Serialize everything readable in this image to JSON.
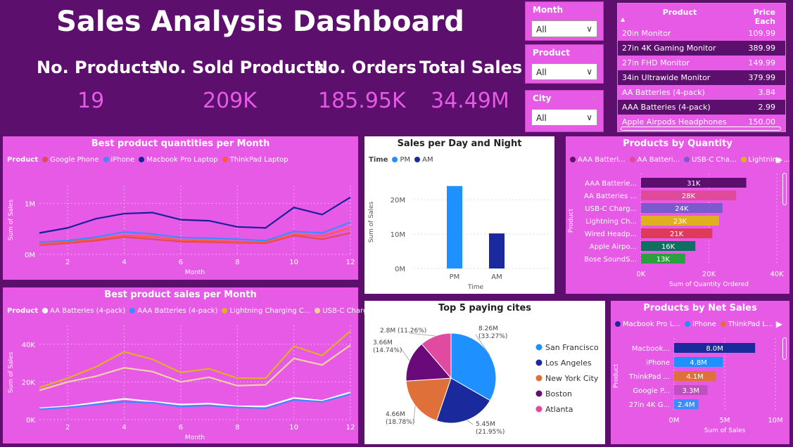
{
  "title": "Sales Analysis Dashboard",
  "kpis": [
    {
      "label": "No. Products",
      "value": "19"
    },
    {
      "label": "No. Sold Products",
      "value": "209K"
    },
    {
      "label": "No. Orders",
      "value": "185.95K"
    },
    {
      "label": "Total Sales",
      "value": "34.49M"
    }
  ],
  "slicers": [
    {
      "label": "Month",
      "value": "All"
    },
    {
      "label": "Product",
      "value": "All"
    },
    {
      "label": "City",
      "value": "All"
    }
  ],
  "price_table": {
    "headers": [
      "Product",
      "Price Each"
    ],
    "rows": [
      [
        "20in Monitor",
        "109.99"
      ],
      [
        "27in 4K Gaming Monitor",
        "389.99"
      ],
      [
        "27in FHD Monitor",
        "149.99"
      ],
      [
        "34in Ultrawide Monitor",
        "379.99"
      ],
      [
        "AA Batteries (4-pack)",
        "3.84"
      ],
      [
        "AAA Batteries (4-pack)",
        "2.99"
      ],
      [
        "Apple Airpods Headphones",
        "150.00"
      ]
    ]
  },
  "colors": {
    "bg": "#5d0f6e",
    "panel": "#e65ae6",
    "google_phone": "#e04a5a",
    "iphone": "#3a8cff",
    "macbook": "#1a1f9c",
    "thinkpad": "#ff5a3a",
    "aa": "#ffffff",
    "aaa": "#3a8cff",
    "lightning": "#e0b020",
    "usbc": "#f0d4a0"
  },
  "chart_data": [
    {
      "type": "line",
      "title": "Best product quantities per Month",
      "legend_title": "Product",
      "xlabel": "Month",
      "ylabel": "Sum of Sales",
      "x": [
        1,
        2,
        3,
        4,
        5,
        6,
        7,
        8,
        9,
        10,
        11,
        12
      ],
      "xticks": [
        "2",
        "4",
        "6",
        "8",
        "10",
        "12"
      ],
      "yticks": [
        "0M",
        "1M"
      ],
      "ylim": [
        0,
        1350000
      ],
      "series": [
        {
          "name": "Google Phone",
          "color": "#e04a5a",
          "values": [
            180000,
            220000,
            270000,
            340000,
            300000,
            250000,
            240000,
            230000,
            220000,
            370000,
            300000,
            420000
          ]
        },
        {
          "name": "iPhone",
          "color": "#3a8cff",
          "values": [
            240000,
            270000,
            340000,
            440000,
            400000,
            330000,
            320000,
            300000,
            270000,
            450000,
            420000,
            630000
          ]
        },
        {
          "name": "Macbook Pro Laptop",
          "color": "#1a1f9c",
          "values": [
            420000,
            520000,
            700000,
            800000,
            820000,
            680000,
            660000,
            540000,
            520000,
            920000,
            780000,
            1120000
          ]
        },
        {
          "name": "ThinkPad Laptop",
          "color": "#ff5a3a",
          "values": [
            200000,
            240000,
            300000,
            370000,
            350000,
            280000,
            270000,
            250000,
            240000,
            390000,
            360000,
            520000
          ]
        }
      ]
    },
    {
      "type": "bar",
      "title": "Sales per Day and Night",
      "legend_title": "Time",
      "xlabel": "Time",
      "ylabel": "Sum of Sales",
      "categories": [
        "PM",
        "AM"
      ],
      "values": [
        24000000,
        10200000
      ],
      "colors": [
        "#1e90ff",
        "#1a2a9c"
      ],
      "yticks": [
        "0M",
        "10M",
        "20M"
      ],
      "ylim": [
        0,
        27000000
      ]
    },
    {
      "type": "bar",
      "title": "Products by Quantity",
      "xlabel": "Sum of Quantity Ordered",
      "ylabel": "Product",
      "legend": [
        "AAA Batteri...",
        "AA Batteri...",
        "USB-C Cha...",
        "Lightning ..."
      ],
      "legend_colors": [
        "#5d0f6e",
        "#e04a9a",
        "#7a5acd",
        "#e0b020"
      ],
      "categories": [
        "AAA Batterie...",
        "AA Batteries ...",
        "USB-C Charg...",
        "Lightning Ch...",
        "Wired Headp...",
        "Apple Airpo...",
        "Bose SoundS..."
      ],
      "values": [
        31000,
        28000,
        24000,
        23000,
        21000,
        16000,
        13000
      ],
      "data_labels": [
        "31K",
        "28K",
        "24K",
        "23K",
        "21K",
        "16K",
        "13K"
      ],
      "colors": [
        "#5d0f6e",
        "#e04a9a",
        "#7a5acd",
        "#e0b020",
        "#e03a5a",
        "#107060",
        "#2aa040"
      ],
      "xticks": [
        "0K",
        "20K",
        "40K"
      ],
      "xlim": [
        0,
        40000
      ]
    },
    {
      "type": "line",
      "title": "Best product sales per Month",
      "legend_title": "Product",
      "legend": [
        "AA Batteries (4-pack)",
        "AAA Batteries (4-pack)",
        "Lightning Charging C...",
        "USB-C Chargin..."
      ],
      "xlabel": "Month",
      "ylabel": "Sum of Sales",
      "x": [
        1,
        2,
        3,
        4,
        5,
        6,
        7,
        8,
        9,
        10,
        11,
        12
      ],
      "xticks": [
        "2",
        "4",
        "6",
        "8",
        "10",
        "12"
      ],
      "yticks": [
        "0K",
        "20K",
        "40K"
      ],
      "ylim": [
        0,
        50000
      ],
      "series": [
        {
          "name": "AA Batteries (4-pack)",
          "color": "#ffffff",
          "values": [
            6000,
            7000,
            9000,
            11000,
            9500,
            8000,
            8500,
            7000,
            7000,
            11500,
            10000,
            14500
          ]
        },
        {
          "name": "AAA Batteries (4-pack)",
          "color": "#3a8cff",
          "values": [
            5500,
            6500,
            8000,
            9500,
            9000,
            7000,
            7500,
            6500,
            6000,
            10500,
            9500,
            13500
          ]
        },
        {
          "name": "Lightning Charging C...",
          "color": "#e0b020",
          "values": [
            17000,
            22000,
            28000,
            36000,
            32000,
            25000,
            27000,
            22000,
            22000,
            39000,
            34000,
            47000
          ]
        },
        {
          "name": "USB-C Chargin...",
          "color": "#f0d4a0",
          "values": [
            15500,
            20000,
            23000,
            27500,
            25500,
            20000,
            22500,
            18000,
            18500,
            32500,
            29000,
            39500
          ]
        }
      ]
    },
    {
      "type": "pie",
      "title": "Top 5 paying cites",
      "labels": [
        "San Francisco",
        "Los Angeles",
        "New York City",
        "Boston",
        "Atlanta"
      ],
      "values": [
        8.26,
        5.45,
        4.66,
        3.66,
        2.8
      ],
      "data_labels": [
        "8.26M (33.27%)",
        "5.45M (21.95%)",
        "4.66M (18.78%)",
        "3.66M (14.74%)",
        "2.8M (11.26%)"
      ],
      "colors": [
        "#1e90ff",
        "#1a2a9c",
        "#e0703a",
        "#6a0a7a",
        "#e04aa0"
      ]
    },
    {
      "type": "bar",
      "title": "Products by Net Sales",
      "xlabel": "Sum of Sales",
      "ylabel": "Product",
      "legend": [
        "Macbook Pro L...",
        "iPhone",
        "ThinkPad L..."
      ],
      "legend_colors": [
        "#1a2a9c",
        "#1e90ff",
        "#e0703a"
      ],
      "categories": [
        "Macbook...",
        "iPhone",
        "ThinkPad ...",
        "Google P...",
        "27in 4K G..."
      ],
      "values": [
        8000000,
        4800000,
        4100000,
        3300000,
        2400000
      ],
      "data_labels": [
        "8.0M",
        "4.8M",
        "4.1M",
        "3.3M",
        "2.4M"
      ],
      "colors": [
        "#1a2a9c",
        "#1e90ff",
        "#e0703a",
        "#c050c0",
        "#3a8cff"
      ],
      "xticks": [
        "0M",
        "5M",
        "10M"
      ],
      "xlim": [
        0,
        10000000
      ]
    }
  ]
}
